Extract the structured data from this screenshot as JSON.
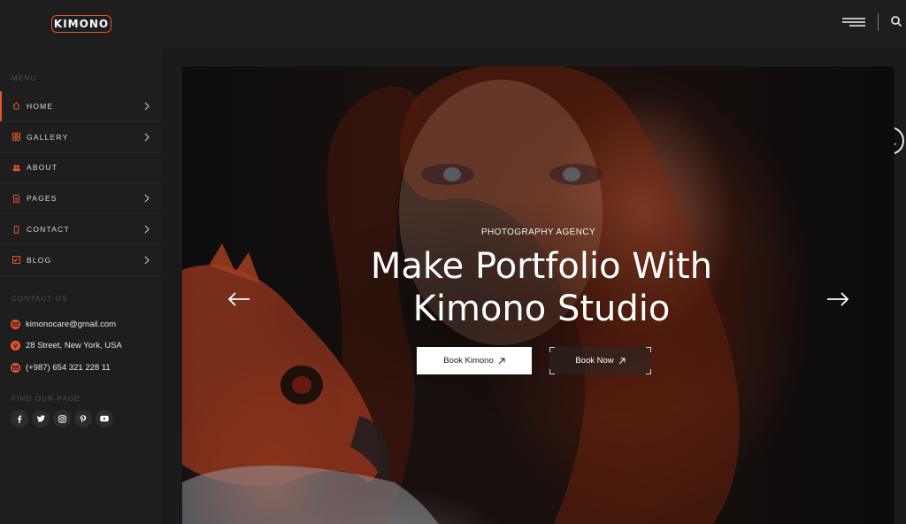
{
  "brand": {
    "logo_text": "KIMONO"
  },
  "sidebar": {
    "menu_label": "MENU",
    "items": [
      {
        "label": "HOME",
        "icon": "home-icon",
        "active": true,
        "has_chevron": true
      },
      {
        "label": "GALLERY",
        "icon": "gallery-icon",
        "active": false,
        "has_chevron": true
      },
      {
        "label": "ABOUT",
        "icon": "users-icon",
        "active": false,
        "has_chevron": false
      },
      {
        "label": "PAGES",
        "icon": "page-icon",
        "active": false,
        "has_chevron": true
      },
      {
        "label": "CONTACT",
        "icon": "phone-icon",
        "active": false,
        "has_chevron": true
      },
      {
        "label": "BLOG",
        "icon": "blog-icon",
        "active": false,
        "has_chevron": true
      }
    ],
    "contact_label": "CONTACT US",
    "contact": {
      "email": "kimonocare@gmail.com",
      "address": "28 Street, New York, USA",
      "phone": "(+987) 654 321 228 11"
    },
    "social_label": "FIND OUR PAGE",
    "socials": [
      "facebook-icon",
      "twitter-icon",
      "instagram-icon",
      "pinterest-icon",
      "youtube-icon"
    ]
  },
  "hero": {
    "eyebrow": "PHOTOGRAPHY AGENCY",
    "title_line1": "Make Portfolio With",
    "title_line2": "Kimono Studio",
    "primary_button": "Book Kimono",
    "secondary_button": "Book Now"
  },
  "colors": {
    "accent": "#e8542a",
    "background": "#1b1b1b",
    "sidebar": "#1e1e1e"
  }
}
